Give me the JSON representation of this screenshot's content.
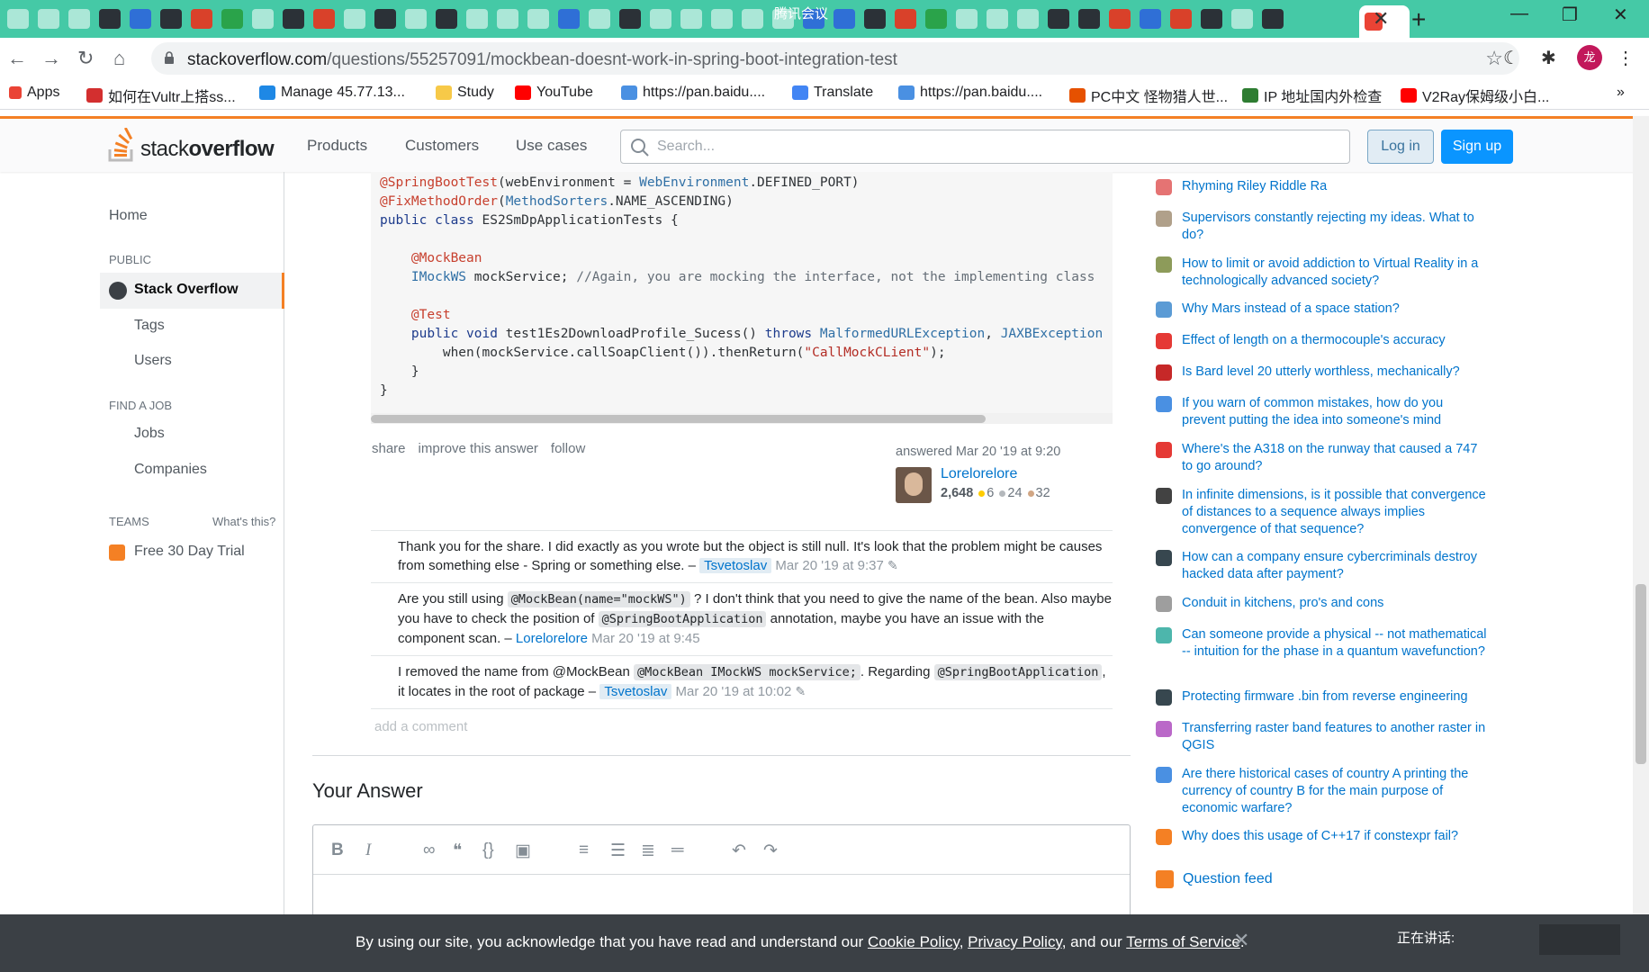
{
  "browser": {
    "meeting_label": "腾讯会议",
    "url_host": "stackoverflow.com",
    "url_path": "/questions/55257091/mockbean-doesnt-work-in-spring-boot-integration-test",
    "profile_initial": "龙",
    "bookmarks": [
      {
        "label": "Apps",
        "icon": "apps-grid-icon",
        "color": "#ea4335"
      },
      {
        "label": "如何在Vultr上搭ss...",
        "icon": "c-icon",
        "color": "#d32f2f"
      },
      {
        "label": "Manage 45.77.13...",
        "icon": "v-icon",
        "color": "#1e88e5"
      },
      {
        "label": "Study",
        "icon": "folder-icon",
        "color": "#f7c948"
      },
      {
        "label": "YouTube",
        "icon": "youtube-icon",
        "color": "#ff0000"
      },
      {
        "label": "https://pan.baidu....",
        "icon": "baidu-pan-icon",
        "color": "#4a90e2"
      },
      {
        "label": "Translate",
        "icon": "translate-icon",
        "color": "#4285f4"
      },
      {
        "label": "https://pan.baidu....",
        "icon": "baidu-pan-icon",
        "color": "#4a90e2"
      },
      {
        "label": "PC中文 怪物猎人世...",
        "icon": "pc-icon",
        "color": "#e65100"
      },
      {
        "label": "IP 地址国内外检查",
        "icon": "v-icon",
        "color": "#2e7d32"
      },
      {
        "label": "V2Ray保姆级小白...",
        "icon": "youtube-icon",
        "color": "#ff0000"
      }
    ],
    "more_bookmarks": "»"
  },
  "so": {
    "logo_light": "stack",
    "logo_bold": "overflow",
    "nav": [
      "Products",
      "Customers",
      "Use cases"
    ],
    "search_placeholder": "Search...",
    "login": "Log in",
    "signup": "Sign up"
  },
  "leftnav": {
    "home": "Home",
    "public": "PUBLIC",
    "stack_overflow": "Stack Overflow",
    "tags": "Tags",
    "users": "Users",
    "find_job": "FIND A JOB",
    "jobs": "Jobs",
    "companies": "Companies",
    "teams": "TEAMS",
    "whats_this": "What's this?",
    "free_trial": "Free 30 Day Trial"
  },
  "code": {
    "line1_ann": "@SpringBootTest",
    "line1_rest_a": "(webEnvironment = ",
    "line1_type": "WebEnvironment",
    "line1_rest_b": ".DEFINED_PORT)",
    "line2_ann": "@FixMethodOrder",
    "line2_rest_a": "(",
    "line2_type": "MethodSorters",
    "line2_rest_b": ".NAME_ASCENDING)",
    "line3_kw": "public class",
    "line3_rest": " ES2SmDpApplicationTests {",
    "line5_ann": "@MockBean",
    "line6_type": "IMockWS",
    "line6_rest": " mockService; ",
    "line6_cmt": "//Again, you are mocking the interface, not the implementing class",
    "line8_ann": "@Test",
    "line9_kw": "public void",
    "line9_rest": " test1Es2DownloadProfile_Sucess() ",
    "line9_kw2": "throws",
    "line9_type1": "MalformedURLException",
    "line9_sep": ", ",
    "line9_type2": "JAXBException",
    "line10_rest_a": "when(mockService.callSoapClient()).thenReturn(",
    "line10_str": "\"CallMockCLient\"",
    "line10_rest_b": ");",
    "line11": "}",
    "line12": "}"
  },
  "post": {
    "menu": [
      "share",
      "improve this answer",
      "follow"
    ],
    "answered": "answered Mar 20 '19 at 9:20",
    "user_name": "Lorelorelore",
    "reputation": "2,648",
    "gold": "6",
    "silver": "24",
    "bronze": "32",
    "badge_colors": {
      "gold": "#ffcc01",
      "silver": "#b4b8bc",
      "bronze": "#d1a684"
    }
  },
  "comments": [
    {
      "text": "Thank you for the share. I did exactly as you wrote but the object is still null. It's look that the problem might be causes from something else - Spring or something else. –",
      "user": "Tsvetoslav",
      "date": "Mar 20 '19 at 9:37"
    },
    {
      "text_a": "Are you still using",
      "code_a": "@MockBean(name=\"mockWS\")",
      "text_b": "? I don't think that you need to give the name of the bean. Also maybe you have to check the position of",
      "code_b": "@SpringBootApplication",
      "text_c": "annotation, maybe you have an issue with the component scan. –",
      "user": "Lorelorelore",
      "date": "Mar 20 '19 at 9:45"
    },
    {
      "text_a": "I removed the name from @MockBean",
      "code_a": "@MockBean  IMockWS mockService;",
      "text_b": ". Regarding",
      "code_b": "@SpringBootApplication",
      "text_c": ", it locates in the root of package –",
      "user": "Tsvetoslav",
      "date": "Mar 20 '19 at 10:02"
    }
  ],
  "add_comment": "add a comment",
  "your_answer": "Your Answer",
  "hot_questions": [
    {
      "title": "Rhyming Riley Riddle Ra",
      "color": "#e57373"
    },
    {
      "title": "Supervisors constantly rejecting my ideas. What to do?",
      "color": "#b0a08a"
    },
    {
      "title": "How to limit or avoid addiction to Virtual Reality in a technologically advanced society?",
      "color": "#8d9b5a"
    },
    {
      "title": "Why Mars instead of a space station?",
      "color": "#5b9bd5"
    },
    {
      "title": "Effect of length on a thermocouple's accuracy",
      "color": "#e53935"
    },
    {
      "title": "Is Bard level 20 utterly worthless, mechanically?",
      "color": "#c62828"
    },
    {
      "title": "If you warn of common mistakes, how do you prevent putting the idea into someone's mind",
      "color": "#4a90e2"
    },
    {
      "title": "Where's the A318 on the runway that caused a 747 to go around?",
      "color": "#e53935"
    },
    {
      "title": "In infinite dimensions, is it possible that convergence of distances to a sequence always implies convergence of that sequence?",
      "color": "#424242"
    },
    {
      "title": "How can a company ensure cybercriminals destroy hacked data after payment?",
      "color": "#37474f"
    },
    {
      "title": "Conduit in kitchens, pro's and cons",
      "color": "#9e9e9e"
    },
    {
      "title": "Can someone provide a physical -- not mathematical -- intuition for the phase in a quantum wavefunction?",
      "color": "#4db6ac"
    },
    {
      "title": "Protecting firmware .bin from reverse engineering",
      "color": "#37474f"
    },
    {
      "title": "Transferring raster band features to another raster in QGIS",
      "color": "#ba68c8"
    },
    {
      "title": "Are there historical cases of country A printing the currency of country B for the main purpose of economic warfare?",
      "color": "#4a90e2"
    },
    {
      "title": "Why does this usage of C++17 if constexpr fail?",
      "color": "#f48024"
    }
  ],
  "question_feed": "Question feed",
  "cookie": {
    "text_a": "By using our site, you acknowledge that you have read and understand our",
    "cookie_policy": "Cookie Policy",
    "sep1": ",",
    "privacy_policy": "Privacy Policy",
    "sep2": ", and our",
    "terms": "Terms of Service",
    "end": "."
  },
  "meeting_speaking": "正在讲话:"
}
